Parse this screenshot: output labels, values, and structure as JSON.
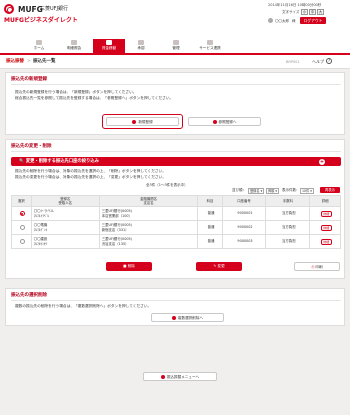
{
  "header": {
    "brand": "MUFG",
    "bank_name": "三菱UFJ銀行",
    "service_name": "MUFGビジネスダイレクト",
    "datetime": "2014年11月16日 10時00分00秒",
    "font_size_label": "文字サイズ",
    "font_small": "小",
    "font_medium": "中",
    "font_large": "大",
    "user_name": "〇〇太郎",
    "user_suffix": "様",
    "logout_label": "ログアウト"
  },
  "nav": [
    {
      "label": "ホーム",
      "active": false
    },
    {
      "label": "明細照会",
      "active": false
    },
    {
      "label": "資金移動",
      "active": true
    },
    {
      "label": "承認",
      "active": false
    },
    {
      "label": "管理",
      "active": false
    },
    {
      "label": "サービス連携",
      "active": false
    }
  ],
  "titlebar": {
    "crumb_a": "振込振替",
    "crumb_sep": ">",
    "crumb_b": "振込先一覧",
    "page_code": "BRP001",
    "help_label": "ヘルプ",
    "help_icon": "?"
  },
  "new_reg": {
    "title": "振込先の新規登録",
    "line1": "振込先の新規登録を行う場合は、「新規登録」ボタンを押してください。",
    "line2": "総合振込先一覧を参照して振込先を登録する場合は、「参照登録へ」ボタンを押してください。",
    "btn_new": "新規登録",
    "btn_ref": "参照登録へ"
  },
  "change": {
    "title": "振込先の変更・削除",
    "filter_label": "変更・削除する振込先口座の絞り込み",
    "filter_plus": "+",
    "line1": "振込先の削除を行う場合は、対象の振込先を選択の上、「削除」ボタンを押してください。",
    "line2": "振込先の変更を行う場合は、対象の振込先を選択の上、「変更」ボタンを押してください。",
    "count_text": "全3件（1～3件を表示中）",
    "sort_label": "並び順：",
    "sort_value": "登録名",
    "order_value": "昇順",
    "per_page_label": "表示件数：",
    "per_page_value": "10件",
    "refresh_label": "再表示",
    "columns": [
      "選択",
      "登録名\n受取人名",
      "金融機関名\n支店名",
      "科目",
      "口座番号",
      "手数料",
      "詳細"
    ],
    "rows": [
      {
        "selected": true,
        "name1": "〇〇トラベル",
        "name2": "ﾏﾙﾏﾙﾄﾗﾍﾞﾙ",
        "bank1": "三菱UFJ銀行(0005)",
        "bank2": "本店営業部（100）",
        "type": "普通",
        "acct": "9000001",
        "fee": "当方負担",
        "detail": "詳細"
      },
      {
        "selected": false,
        "name1": "〇〇電機",
        "name2": "ﾏﾙﾏﾙﾃﾞﾝｷ",
        "bank1": "三菱UFJ銀行(0005)",
        "bank2": "新宿支店（331）",
        "type": "普通",
        "acct": "9000002",
        "fee": "当方負担",
        "detail": "詳細"
      },
      {
        "selected": false,
        "name1": "〇〇建設",
        "name2": "ﾏﾙﾏﾙｹﾝｾﾂ",
        "bank1": "三菱UFJ銀行(0005)",
        "bank2": "渋谷支店（135）",
        "type": "普通",
        "acct": "9000003",
        "fee": "当方負担",
        "detail": "詳細"
      }
    ],
    "btn_delete": "削除",
    "btn_change": "変更",
    "btn_print": "印刷"
  },
  "batch": {
    "title": "振込先の選択削除",
    "line1": "複数の振込先の削除を行う場合は、「複数選択削除へ」ボタンを押してください。",
    "btn": "複数選択削除へ"
  },
  "footer": {
    "btn_back": "振込振替メニューへ"
  }
}
